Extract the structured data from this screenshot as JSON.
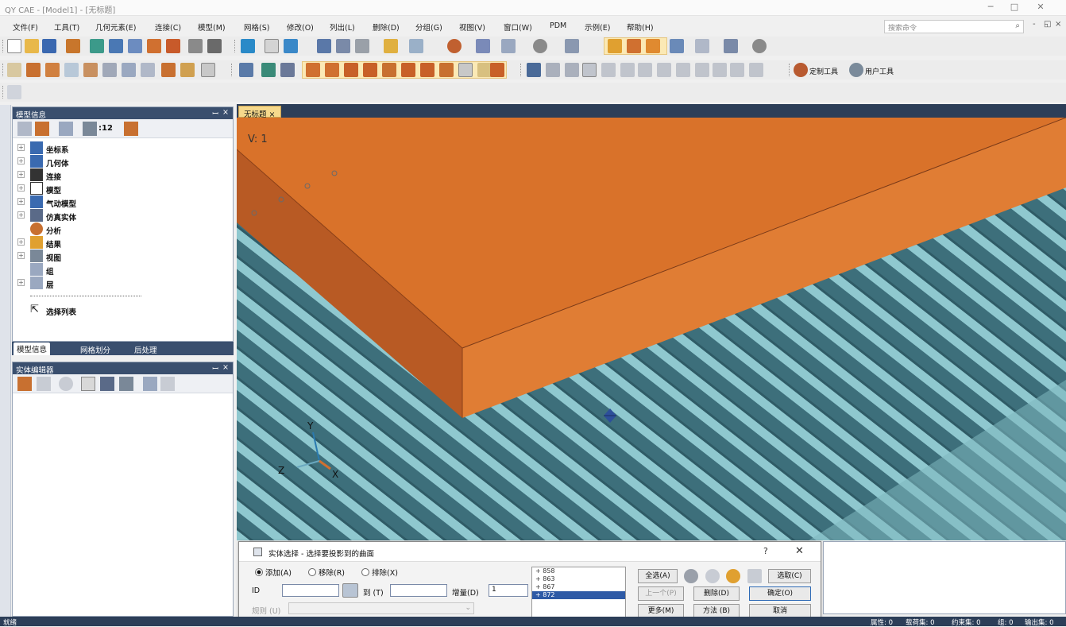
{
  "window": {
    "title": "QY CAE - [Model1] - [无标题]",
    "minimize": "─",
    "maximize": "□",
    "close": "✕"
  },
  "menu": [
    "文件(F)",
    "工具(T)",
    "几何元素(E)",
    "连接(C)",
    "模型(M)",
    "网格(S)",
    "修改(O)",
    "列出(L)",
    "删除(D)",
    "分组(G)",
    "视图(V)",
    "窗口(W)",
    "PDM",
    "示例(E)",
    "帮助(H)"
  ],
  "search": {
    "placeholder": "搜索命令"
  },
  "toolbar": {
    "custom_tools": "定制工具",
    "user_tools": "用户工具",
    "count": ":12"
  },
  "model_panel": {
    "title": "模型信息",
    "tree": [
      "坐标系",
      "几何体",
      "连接",
      "模型",
      "气动模型",
      "仿真实体",
      "分析",
      "结果",
      "视图",
      "组",
      "层",
      "",
      "选择列表"
    ],
    "tabs": [
      "模型信息",
      "网格划分",
      "后处理"
    ]
  },
  "entity_panel": {
    "title": "实体编辑器"
  },
  "viewport": {
    "tab": "无标题",
    "view_label": "V: 1",
    "axes": {
      "y": "Y",
      "z": "Z",
      "x": "X"
    }
  },
  "dialog": {
    "title": "实体选择 - 选择要投影到的曲面",
    "radios": [
      "添加(A)",
      "移除(R)",
      "排除(X)"
    ],
    "id_label": "ID",
    "to_label": "到 (T)",
    "increment_label": "增量(D)",
    "increment_value": "1",
    "rule_label": "规则 (U)",
    "list": [
      "858",
      "863",
      "867",
      "872"
    ],
    "buttons": {
      "select_all": "全选(A)",
      "prev": "上一个(P)",
      "delete": "删除(D)",
      "ok": "确定(O)",
      "more": "更多(M)",
      "method": "方法 (B)",
      "cancel": "取消",
      "pick": "选取(C)"
    }
  },
  "status": {
    "ready": "就绪",
    "items": [
      "属性: 0",
      "载荷集: 0",
      "约束集: 0",
      "组: 0",
      "输出集: 0"
    ]
  },
  "colors": {
    "orange": "#d9722a",
    "teal": "#4d8a96",
    "stripe": "#8fc8cf",
    "panel_head": "#3a4f6e"
  }
}
